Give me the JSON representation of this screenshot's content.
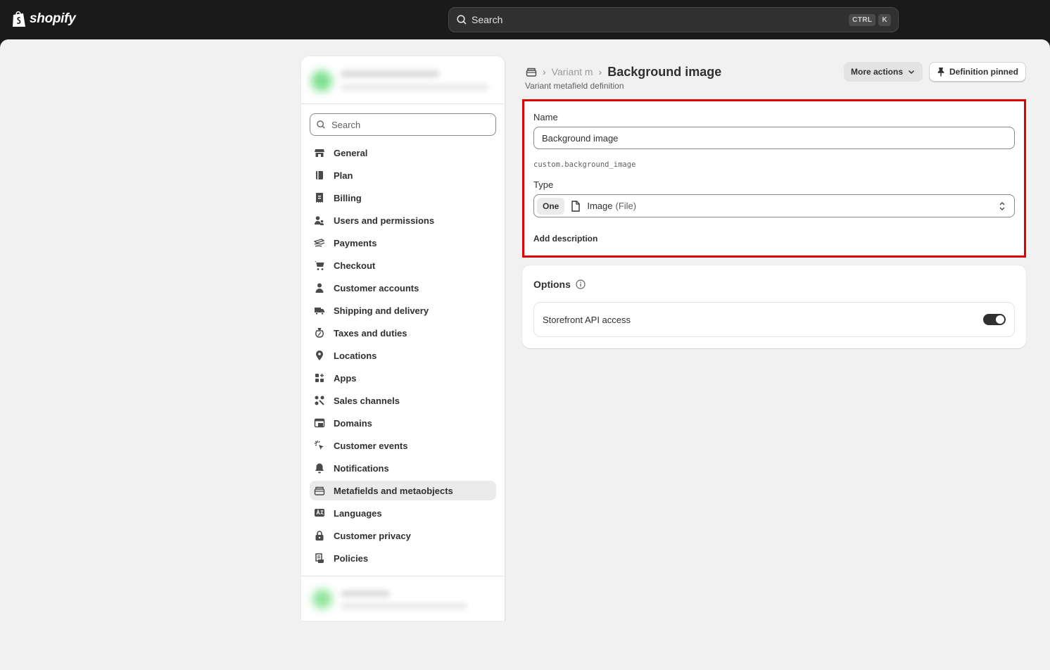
{
  "app": {
    "brand": "shopify",
    "search_label": "Search",
    "shortcut_keys": [
      "CTRL",
      "K"
    ]
  },
  "sidebar": {
    "search_placeholder": "Search",
    "items": [
      {
        "label": "General",
        "icon": "store-icon"
      },
      {
        "label": "Plan",
        "icon": "plan-icon"
      },
      {
        "label": "Billing",
        "icon": "receipt-icon"
      },
      {
        "label": "Users and permissions",
        "icon": "users-icon"
      },
      {
        "label": "Payments",
        "icon": "payments-icon"
      },
      {
        "label": "Checkout",
        "icon": "cart-icon"
      },
      {
        "label": "Customer accounts",
        "icon": "person-icon"
      },
      {
        "label": "Shipping and delivery",
        "icon": "truck-icon"
      },
      {
        "label": "Taxes and duties",
        "icon": "tax-icon"
      },
      {
        "label": "Locations",
        "icon": "pin-icon"
      },
      {
        "label": "Apps",
        "icon": "apps-icon"
      },
      {
        "label": "Sales channels",
        "icon": "channels-icon"
      },
      {
        "label": "Domains",
        "icon": "domain-icon"
      },
      {
        "label": "Customer events",
        "icon": "cursor-click-icon"
      },
      {
        "label": "Notifications",
        "icon": "bell-icon"
      },
      {
        "label": "Metafields and metaobjects",
        "icon": "metafields-icon",
        "active": true
      },
      {
        "label": "Languages",
        "icon": "language-icon"
      },
      {
        "label": "Customer privacy",
        "icon": "lock-icon"
      },
      {
        "label": "Policies",
        "icon": "policy-icon"
      }
    ]
  },
  "header": {
    "breadcrumb_prev": "Variant m",
    "title": "Background image",
    "subtitle": "Variant metafield definition",
    "more_actions_label": "More actions",
    "pinned_label": "Definition pinned"
  },
  "definition": {
    "name_label": "Name",
    "name_value": "Background image",
    "namespace_key": "custom.background_image",
    "type_label": "Type",
    "type_cardinality": "One",
    "type_name": "Image",
    "type_sub": "(File)",
    "add_description_label": "Add description"
  },
  "options": {
    "title": "Options",
    "storefront_label": "Storefront API access",
    "storefront_enabled": true
  },
  "colors": {
    "topbar": "#1a1a1a",
    "surface": "#f1f1f1",
    "highlight_border": "#e00000",
    "toggle_on": "#303030"
  }
}
